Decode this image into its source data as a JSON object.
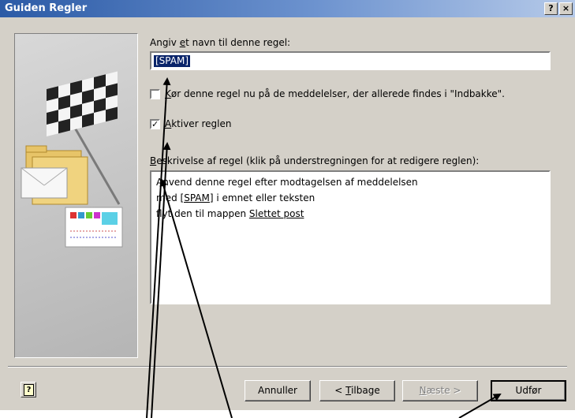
{
  "window": {
    "title": "Guiden Regler",
    "help_glyph": "?",
    "close_glyph": "×"
  },
  "form": {
    "name_label_pre": "Angiv ",
    "name_label_accel": "e",
    "name_label_post": "t navn til denne regel:",
    "name_value": "[SPAM]",
    "run_now": {
      "checked": false,
      "accel": "K",
      "label": "ør denne regel nu på de meddelelser, der allerede findes i \"Indbakke\"."
    },
    "activate": {
      "checked": true,
      "check_glyph": "✓",
      "accel": "A",
      "label": "ktiver reglen"
    },
    "desc_label_accel": "B",
    "desc_label": "eskrivelse af regel (klik på understregningen for at redigere reglen):",
    "desc_lines": {
      "line1": "Anvend denne regel efter modtagelsen af meddelelsen",
      "line2_pre": "med ",
      "line2_link": "[SPAM]",
      "line2_post": " i emnet eller teksten",
      "line3_pre": "flyt den til mappen ",
      "line3_link": "Slettet post"
    }
  },
  "buttons": {
    "help": "?",
    "cancel": "Annuller",
    "back_pre": "< ",
    "back_accel": "T",
    "back_post": "ilbage",
    "next_accel": "N",
    "next_post": "æste >",
    "finish": "Udfør"
  },
  "icons": {
    "side_art": "checkered-flag-folders-illustration",
    "annotation": "arrow-annotation"
  }
}
